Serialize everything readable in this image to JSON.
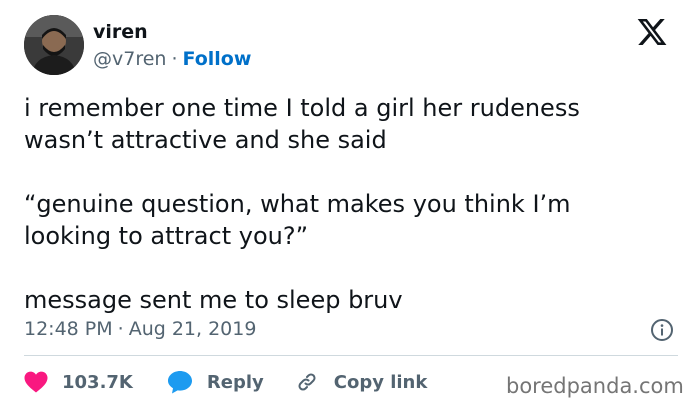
{
  "author": {
    "name": "viren",
    "handle": "@v7ren",
    "separator": "·",
    "follow_label": "Follow"
  },
  "brand_icon": "x-logo-icon",
  "tweet": {
    "paragraphs": [
      "i remember one time I told a girl her rudeness wasn’t attractive and she said",
      "“genuine question, what makes you think I’m looking to attract you?”",
      "message sent me to sleep bruv"
    ],
    "time": "12:48 PM",
    "date": "Aug 21, 2019"
  },
  "actions": {
    "likes": "103.7K",
    "reply_label": "Reply",
    "copy_link_label": "Copy link"
  },
  "watermark": "boredpanda.com",
  "colors": {
    "text": "#0f1419",
    "muted": "#536471",
    "follow": "#0070c9",
    "like": "#f91880",
    "reply": "#1d9bf0",
    "divider": "#cfd9de"
  }
}
